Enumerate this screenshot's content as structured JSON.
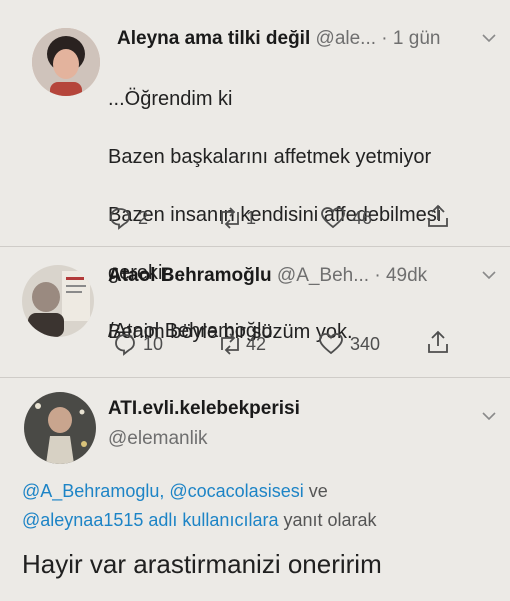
{
  "tweets": [
    {
      "name": "Aleyna ama tilki değil",
      "handle": "@ale...",
      "time": "1 gün",
      "lines": [
        "...Öğrendim ki",
        "Bazen başkalarını affetmek yetmiyor",
        "Bazen insanın kendisini affedebilmesi",
        "gerekir...",
        " /Ataol Behramoğlu"
      ],
      "replies": "2",
      "retweets": "1",
      "likes": "46"
    },
    {
      "name": "Ataol Behramoğlu",
      "handle": "@A_Beh...",
      "time": "49dk",
      "lines": [
        "Benim böyle bir sözüm yok."
      ],
      "replies": "10",
      "retweets": "42",
      "likes": "340"
    }
  ],
  "reply": {
    "name": "ATI.evli.kelebekperisi",
    "handle": "@elemanlik",
    "mention_1": "@A_Behramoglu,",
    "mention_2": "@cocacolasisesi",
    "and_word": "ve",
    "mention_3": "@aleynaa1515",
    "reply_suffix_1": "adlı kullanıcılara",
    "reply_suffix_2": "yanıt olarak",
    "text": "Hayir var arastirmanizi oneririm"
  },
  "icons": {
    "reply": "reply-icon",
    "retweet": "retweet-icon",
    "like": "heart-icon",
    "share": "share-icon",
    "menu": "chevron-down-icon"
  },
  "colors": {
    "background": "#eceae6",
    "mention": "#1d84c6",
    "muted": "#6f6f6f"
  }
}
